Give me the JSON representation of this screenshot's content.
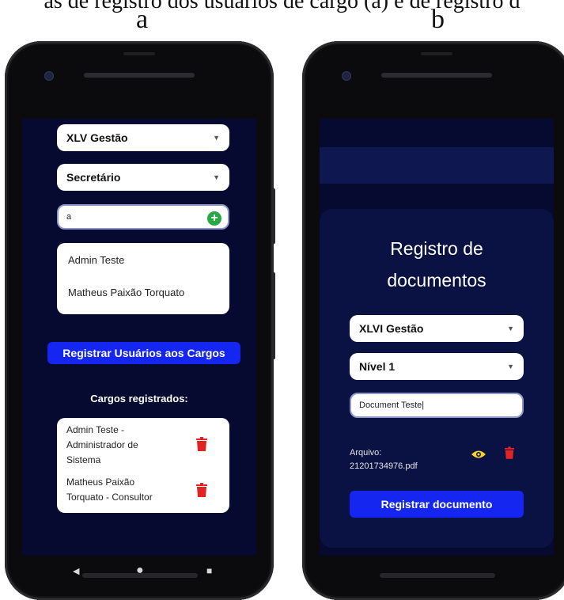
{
  "caption": "as de registro dos usuários de cargo (a) e de registro d",
  "panel_a": {
    "letter": "a",
    "gestao_select": "XLV Gestão",
    "cargo_select": "Secretário",
    "search_input_value": "a",
    "user_list": [
      "Admin Teste",
      "Matheus Paixão Torquato"
    ],
    "register_button": "Registrar Usuários aos Cargos",
    "registered_title": "Cargos registrados:",
    "registered_items": [
      [
        "Admin Teste -",
        "Administrador de",
        "Sistema"
      ],
      [
        "Matheus Paixão",
        "Torquato - Consultor"
      ]
    ]
  },
  "panel_b": {
    "letter": "b",
    "title_line1": "Registro de",
    "title_line2": "documentos",
    "gestao_select": "XLVI Gestão",
    "nivel_select": "Nível 1",
    "document_input_value": "Document Teste",
    "file_label": "Arquivo:",
    "file_name": "21201734976.pdf",
    "register_button": "Registrar documento"
  },
  "colors": {
    "screen_bg": "#060a30",
    "button_blue": "#1426f0",
    "add_green": "#28a745",
    "trash_red": "#e02424",
    "eye_yellow": "#f2d32b"
  },
  "icons": [
    "caret-down-icon",
    "plus-circle-icon",
    "trash-icon",
    "eye-icon",
    "back-nav-icon",
    "home-nav-icon",
    "recents-nav-icon"
  ]
}
